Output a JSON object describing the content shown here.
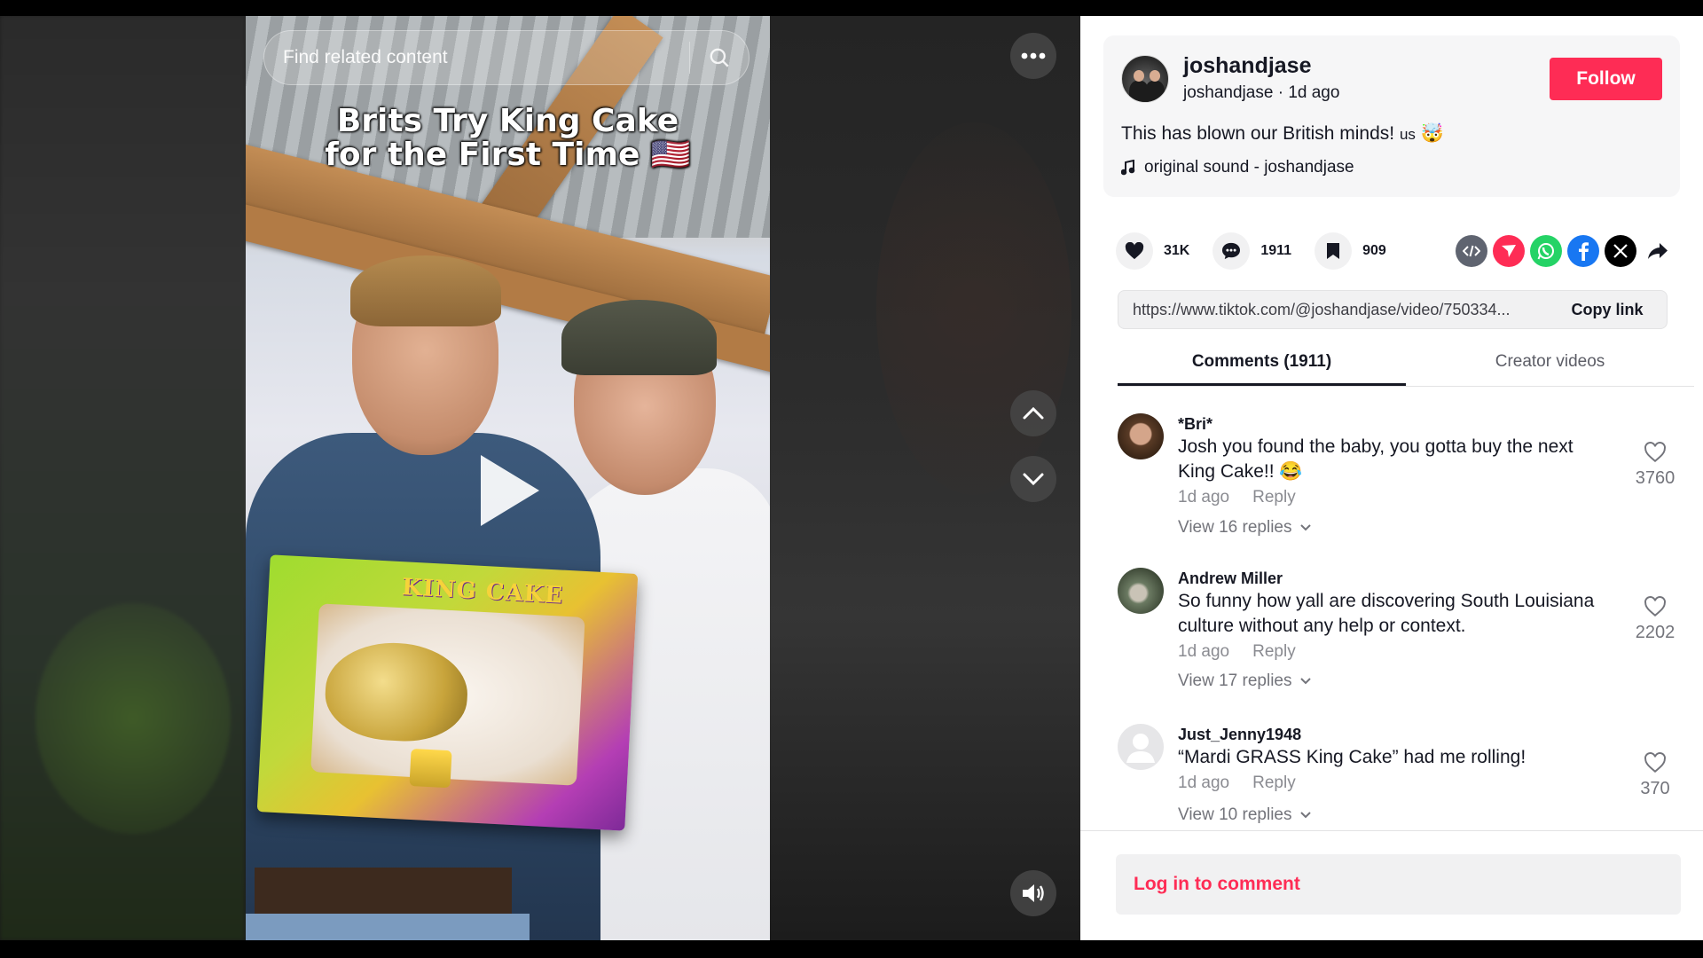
{
  "video": {
    "search_placeholder": "Find related content",
    "caption_line1": "Brits Try King Cake",
    "caption_line2": "for the First Time 🇺🇸",
    "box_label": "KING CAKE"
  },
  "author": {
    "username": "joshandjase",
    "handle": "joshandjase",
    "posted": "1d ago",
    "follow_label": "Follow",
    "caption": "This has blown our British minds!",
    "caption_tag": "us",
    "caption_emoji": "🤯",
    "sound": "original sound - joshandjase"
  },
  "stats": {
    "likes": "31K",
    "comments": "1911",
    "saves": "909"
  },
  "share": {
    "url": "https://www.tiktok.com/@joshandjase/video/750334...",
    "copy_label": "Copy link"
  },
  "tabs": [
    {
      "label": "Comments (1911)",
      "active": true
    },
    {
      "label": "Creator videos",
      "active": false
    }
  ],
  "comments": [
    {
      "name": "*Bri*",
      "text": "Josh you found the baby, you gotta buy the next King Cake!! 😂",
      "time": "1d ago",
      "reply": "Reply",
      "view_replies": "View 16 replies",
      "likes": "3760"
    },
    {
      "name": "Andrew Miller",
      "text": "So funny how yall are discovering South Louisiana culture without any help or context.",
      "time": "1d ago",
      "reply": "Reply",
      "view_replies": "View 17 replies",
      "likes": "2202"
    },
    {
      "name": "Just_Jenny1948",
      "text": "“Mardi GRASS King Cake” had me rolling!",
      "time": "1d ago",
      "reply": "Reply",
      "view_replies": "View 10 replies",
      "likes": "370"
    }
  ],
  "login_prompt": "Log in to comment",
  "colors": {
    "accent": "#fe2c55",
    "text": "#161823",
    "muted": "#8a8b91"
  },
  "icons": [
    "search-icon",
    "more-icon",
    "chevron-up-icon",
    "chevron-down-icon",
    "volume-icon",
    "heart-icon",
    "comment-icon",
    "bookmark-icon",
    "embed-icon",
    "friends-icon",
    "whatsapp-icon",
    "facebook-icon",
    "x-icon",
    "share-arrow-icon",
    "music-note-icon"
  ]
}
